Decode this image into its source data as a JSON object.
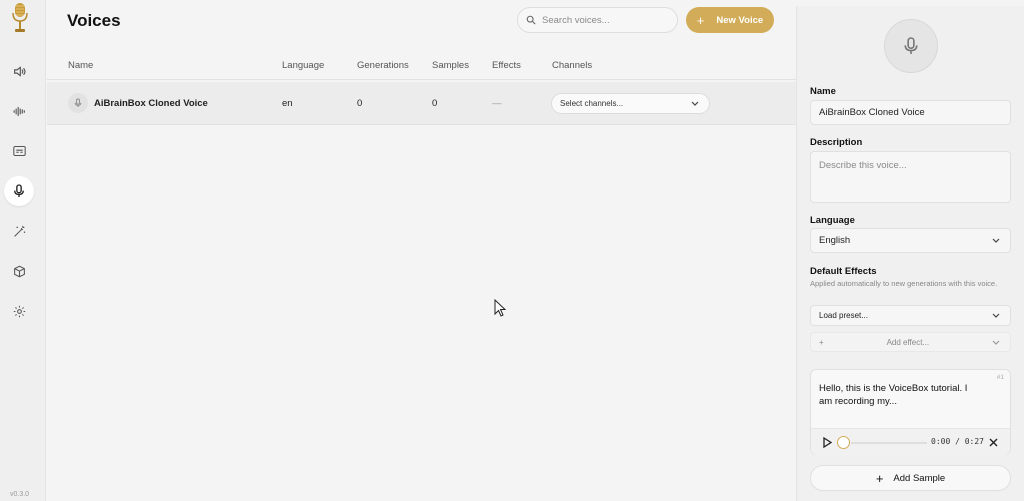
{
  "sidebar": {
    "items": [
      {
        "icon": "speaker-icon"
      },
      {
        "icon": "waveform-icon"
      },
      {
        "icon": "captions-icon"
      },
      {
        "icon": "microphone-icon",
        "active": true
      },
      {
        "icon": "magic-wand-icon"
      },
      {
        "icon": "box-icon"
      },
      {
        "icon": "gear-icon"
      }
    ],
    "version": "v0.3.0"
  },
  "main": {
    "title": "Voices",
    "search_placeholder": "Search voices...",
    "new_voice_label": "New Voice",
    "columns": [
      "Name",
      "Language",
      "Generations",
      "Samples",
      "Effects",
      "Channels"
    ],
    "rows": [
      {
        "name": "AiBrainBox Cloned Voice",
        "language": "en",
        "generations": "0",
        "samples": "0",
        "effects": "—",
        "channels": "Select channels..."
      }
    ]
  },
  "panel": {
    "name_label": "Name",
    "name_value": "AiBrainBox Cloned Voice",
    "description_label": "Description",
    "description_placeholder": "Describe this voice...",
    "language_label": "Language",
    "language_value": "English",
    "effects_label": "Default Effects",
    "effects_hint": "Applied automatically to new generations with this voice.",
    "preset_value": "Load preset...",
    "add_effect_label": "Add effect...",
    "sample": {
      "number": "#1",
      "text": "Hello, this is the VoiceBox tutorial. I am recording my...",
      "time": "0:00 / 0:27",
      "progress": 0
    },
    "add_sample_label": "Add Sample"
  },
  "colors": {
    "accent": "#d2ac58"
  }
}
